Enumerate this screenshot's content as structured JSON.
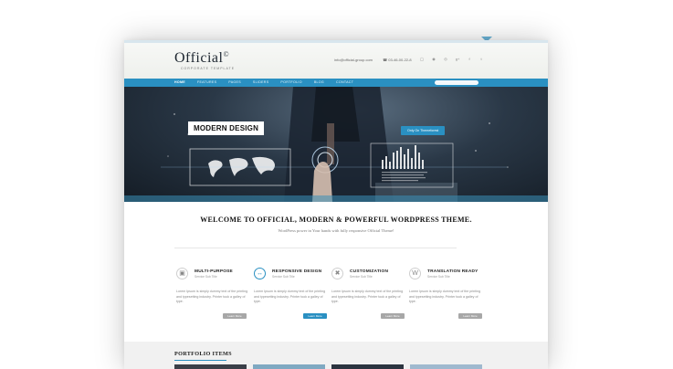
{
  "brand": {
    "logo": "Official",
    "logo_mark": "©",
    "tagline": "CORPORATE TEMPLATE"
  },
  "header": {
    "email": "info@official-group.com",
    "phone": "☎ 03-46-00-22-8"
  },
  "socials": [
    "instagram-icon",
    "pinterest-icon",
    "dribbble-icon",
    "google-plus-icon",
    "facebook-icon",
    "twitter-icon"
  ],
  "nav": {
    "items": [
      "HOME",
      "FEATURES",
      "PAGES",
      "SLIDERS",
      "PORTFOLIO",
      "BLOG",
      "CONTACT"
    ],
    "active": "HOME"
  },
  "hero": {
    "title": "MODERN DESIGN",
    "button": "Only On Themeforest"
  },
  "welcome": {
    "title": "WELCOME TO OFFICIAL, MODERN & POWERFUL WORDPRESS THEME.",
    "subtitle": "WordPress power in Your hands with fully responsive Official Theme!"
  },
  "features": [
    {
      "icon": "box-icon",
      "title": "MULTI-PURPOSE",
      "sub": "Service Sub Title",
      "body": "Lorem Ipsum is simply dummy text of the printing and typesetting industry. Printer took a galley of type.",
      "button": "Learn More"
    },
    {
      "icon": "responsive-icon",
      "title": "RESPONSIVE DESIGN",
      "sub": "Service Sub Title",
      "body": "Lorem Ipsum is simply dummy text of the printing and typesetting industry. Printer took a galley of type.",
      "button": "Learn More"
    },
    {
      "icon": "wrench-icon",
      "title": "CUSTOMIZATION",
      "sub": "Service Sub Title",
      "body": "Lorem Ipsum is simply dummy text of the printing and typesetting industry. Printer took a galley of type.",
      "button": "Learn More"
    },
    {
      "icon": "wordpress-icon",
      "title": "TRANSLATION READY",
      "sub": "Service Sub Title",
      "body": "Lorem Ipsum is simply dummy text of the printing and typesetting industry. Printer took a galley of type.",
      "button": "Learn More"
    }
  ],
  "portfolio": {
    "title": "PORTFOLIO ITEMS"
  },
  "colors": {
    "accent": "#2a90c2",
    "hero_dark": "#1a2430",
    "button_gray": "#a7a7a7"
  }
}
